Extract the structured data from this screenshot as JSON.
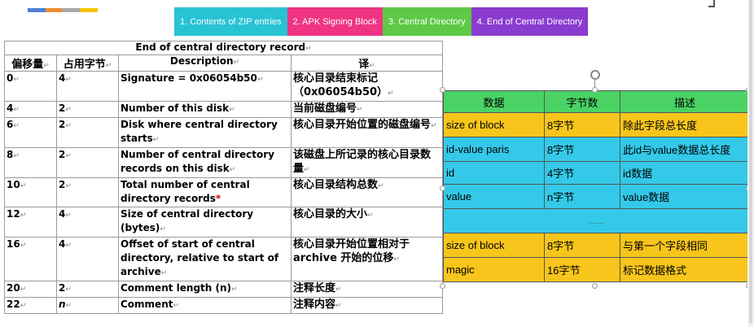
{
  "color_strip": [
    "#4f7fd6",
    "#ef8d2e",
    "#a9a9a9",
    "#f6c400"
  ],
  "tabs": [
    {
      "label": "1. Contents of ZIP entries",
      "color": "#27c3d5"
    },
    {
      "label": "2. APK Signing Block",
      "color": "#ee3483"
    },
    {
      "label": "3. Central Directory",
      "color": "#5ec945"
    },
    {
      "label": "4. End of Central Directory",
      "color": "#8b3bd0"
    }
  ],
  "doc_table": {
    "title": "End of central directory record",
    "headers": [
      "偏移量",
      "占用字节",
      "Description",
      "译"
    ],
    "rows": [
      {
        "offset": "0",
        "bytes": "4",
        "desc": "Signature = 0x06054b50",
        "zh": "核心目录结束标记（0x06054b50）"
      },
      {
        "offset": "4",
        "bytes": "2",
        "desc": "Number of this disk",
        "zh": "当前磁盘编号"
      },
      {
        "offset": "6",
        "bytes": "2",
        "desc": "Disk where central directory starts",
        "zh": "核心目录开始位置的磁盘编号"
      },
      {
        "offset": "8",
        "bytes": "2",
        "desc": "Number of central directory records on this disk",
        "zh": "该磁盘上所记录的核心目录数量"
      },
      {
        "offset": "10",
        "bytes": "2",
        "desc": "Total number of central directory records",
        "zh": "核心目录结构总数"
      },
      {
        "offset": "12",
        "bytes": "4",
        "desc": "Size of central directory (bytes)",
        "zh": "核心目录的大小"
      },
      {
        "offset": "16",
        "bytes": "4",
        "desc": "Offset of start of central directory, relative to start of archive",
        "zh": "核心目录开始位置相对于archive 开始的位移"
      },
      {
        "offset": "20",
        "bytes": "2",
        "desc": "Comment length (n)",
        "zh": "注释长度"
      },
      {
        "offset": "22",
        "bytes": "n",
        "desc": "Comment",
        "zh": "注释内容"
      }
    ]
  },
  "block_table": {
    "headers": [
      "数据",
      "字节数",
      "描述"
    ],
    "rows": [
      {
        "data": "size of block",
        "bytes": "8字节",
        "desc": "除此字段总长度",
        "kind": "y"
      },
      {
        "data": "id-value paris",
        "bytes": "8字节",
        "desc": "此id与value数据总长度",
        "kind": "c"
      },
      {
        "data": "id",
        "bytes": "4字节",
        "desc": "id数据",
        "kind": "c"
      },
      {
        "data": "value",
        "bytes": "n字节",
        "desc": "value数据",
        "kind": "c"
      },
      {
        "ellipsis": "……",
        "kind": "c"
      },
      {
        "data": "size of block",
        "bytes": "8字节",
        "desc": "与第一个字段相同",
        "kind": "y"
      },
      {
        "data": "magic",
        "bytes": "16字节",
        "desc": "标记数据格式",
        "kind": "y"
      }
    ]
  }
}
